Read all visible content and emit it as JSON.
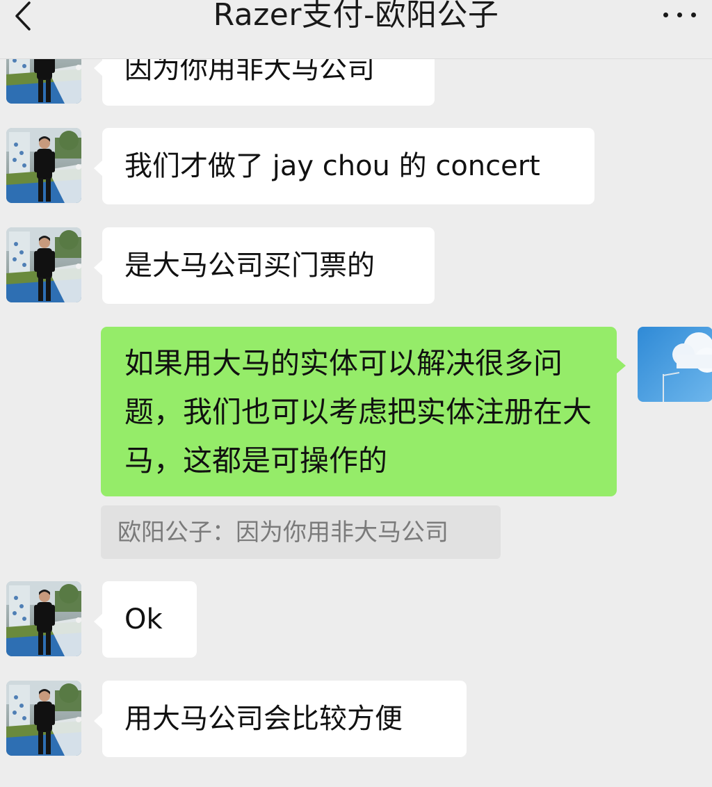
{
  "header": {
    "title": "Razer支付-欧阳公子",
    "back_icon": "chevron-left-icon",
    "more_icon": "more-dots-icon"
  },
  "messages": [
    {
      "side": "left",
      "text": "因为你用非大马公司"
    },
    {
      "side": "left",
      "text": "我们才做了 jay chou 的 concert"
    },
    {
      "side": "left",
      "text": "是大马公司买门票的"
    },
    {
      "side": "right",
      "text": "如果用大马的实体可以解决很多问题，我们也可以考虑把实体注册在大马，这都是可操作的"
    },
    {
      "side": "left",
      "text": "Ok"
    },
    {
      "side": "left",
      "text": "用大马公司会比较方便"
    }
  ],
  "quote": {
    "sender": "欧阳公子",
    "separator": "：",
    "text": "因为你用非大马公司"
  },
  "colors": {
    "background": "#ededed",
    "incoming_bubble": "#ffffff",
    "outgoing_bubble": "#95ec69",
    "quote_background": "#e1e1e1"
  }
}
